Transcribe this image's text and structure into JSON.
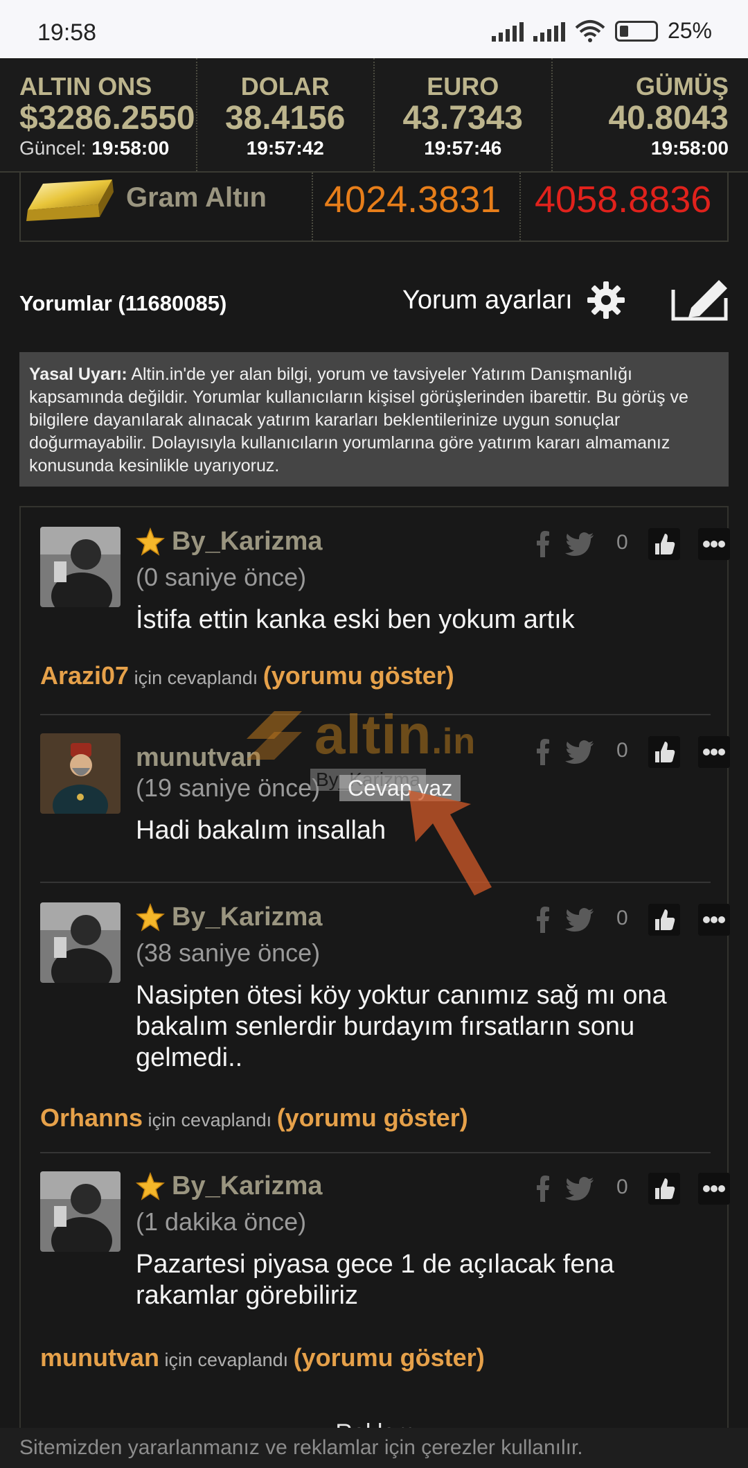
{
  "status_bar": {
    "time": "19:58",
    "battery": "25%"
  },
  "ticker": [
    {
      "name": "ALTIN ONS",
      "value": "$3286.2550",
      "time_label": "Güncel:",
      "time": "19:58:00"
    },
    {
      "name": "DOLAR",
      "value": "38.4156",
      "time": "19:57:42"
    },
    {
      "name": "EURO",
      "value": "43.7343",
      "time": "19:57:46"
    },
    {
      "name": "GÜMÜŞ",
      "value": "40.8043",
      "time": "19:58:00"
    }
  ],
  "gram": {
    "name": "Gram Altın",
    "buy": "4024.3831",
    "sell": "4058.8836",
    "buy_color": "#e77e1a",
    "sell_color": "#e0221c"
  },
  "comments_header": {
    "title": "Yorumlar (11680085)",
    "settings_label": "Yorum ayarları"
  },
  "disclaimer": {
    "label": "Yasal Uyarı:",
    "text": " Altin.in'de yer alan bilgi, yorum ve tavsiyeler Yatırım Danışmanlığı kapsamında değildir. Yorumlar kullanıcıların kişisel görüşlerinden ibarettir. Bu görüş ve bilgilere dayanılarak alınacak yatırım kararları beklentilerinize uygun sonuçlar doğurmayabilir. Dolayısıyla kullanıcıların yorumlarına göre yatırım kararı almamanız konusunda kesinlikle uyarıyoruz."
  },
  "comments": [
    {
      "user": "By_Karizma",
      "starred": true,
      "time": "(0 saniye önce)",
      "text": "İstifa ettin kanka eski ben yokum artık",
      "likes": "0",
      "reply_to": "Arazi07",
      "reply_label": "için cevaplandı",
      "show_label": "(yorumu göster)"
    },
    {
      "user": "munutvan",
      "starred": false,
      "time": "(19 saniye önce)",
      "text": "Hadi bakalım insallah",
      "likes": "0"
    },
    {
      "user": "By_Karizma",
      "starred": true,
      "time": "(38 saniye önce)",
      "text": "Nasipten ötesi köy yoktur canımız sağ mı ona bakalım senlerdir burdayım fırsatların sonu gelmedi..",
      "likes": "0",
      "reply_to": "Orhanns",
      "reply_label": "için cevaplandı",
      "show_label": "(yorumu göster)"
    },
    {
      "user": "By_Karizma",
      "starred": true,
      "time": "(1 dakika önce)",
      "text": "Pazartesi piyasa gece 1 de açılacak fena rakamlar görebiliriz",
      "likes": "0",
      "reply_to": "munutvan",
      "reply_label": "için cevaplandı",
      "show_label": "(yorumu göster)"
    }
  ],
  "watermark": {
    "brand": "altin",
    "tld": ".in",
    "tooltip_user": "By_Karizma",
    "tooltip_action": "Cevap yaz"
  },
  "reklam": "Reklam",
  "cookie_notice": "Sitemizden yararlanmanız ve reklamlar için çerezler kullanılır."
}
